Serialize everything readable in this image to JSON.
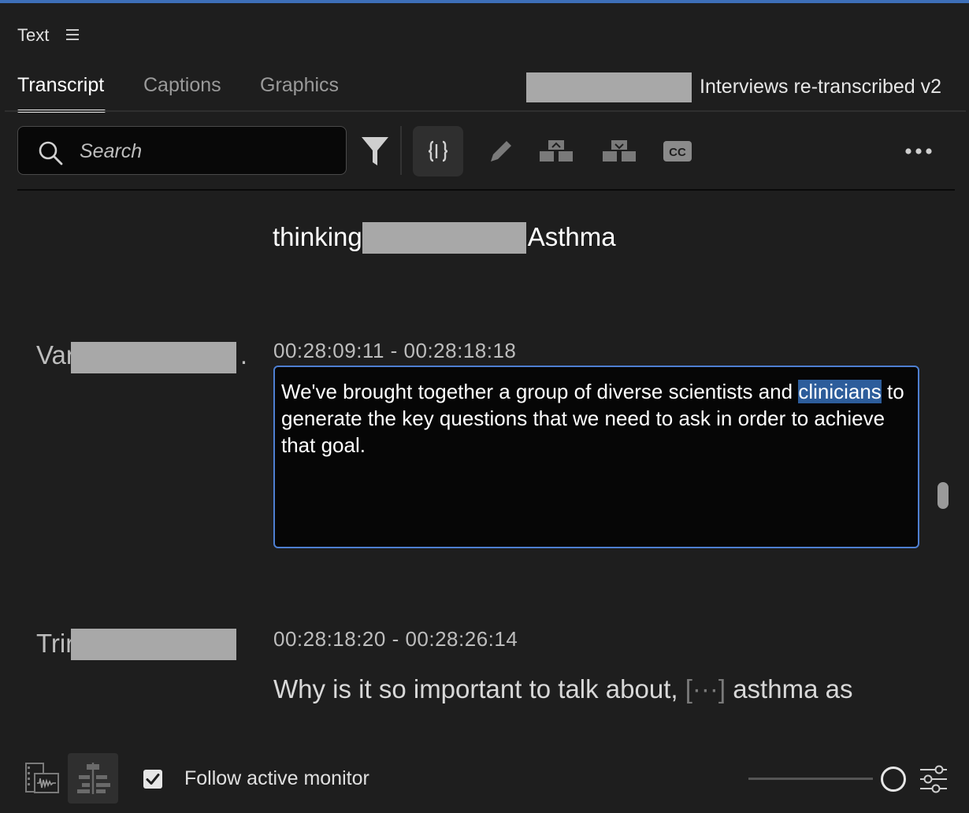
{
  "panel": {
    "title": "Text"
  },
  "tabs": [
    {
      "label": "Transcript",
      "active": true
    },
    {
      "label": "Captions",
      "active": false
    },
    {
      "label": "Graphics",
      "active": false
    }
  ],
  "sequence": {
    "title": "Interviews re-transcribed v2"
  },
  "search": {
    "placeholder": "Search"
  },
  "toolbar": {
    "icons": [
      "filter-icon",
      "merge-segments-icon",
      "edit-pencil-icon",
      "split-segment-icon",
      "merge-clips-icon",
      "create-captions-icon",
      "more-icon"
    ]
  },
  "transcript": {
    "prev_line": {
      "before": "thinking",
      "after": "Asthma"
    },
    "segments": [
      {
        "speaker_visible": "Var",
        "speaker_trailing": ".",
        "timecode": "00:28:09:11 - 00:28:18:18",
        "text_before": "We've brought together a group of diverse scientists and ",
        "text_highlight": "clinicians",
        "text_after": " to generate the key questions that we need to ask in order to achieve that goal."
      },
      {
        "speaker_visible": "Trir",
        "timecode": "00:28:18:20 - 00:28:26:14",
        "text_before": "Why is it so important to talk about, ",
        "ellipsis": "[···]",
        "text_after": " asthma as"
      }
    ]
  },
  "footer": {
    "follow_label": "Follow active monitor",
    "follow_checked": true,
    "zoom_level": 1.0
  },
  "colors": {
    "accent": "#4e7fd1",
    "highlight": "#2d5d9b",
    "background": "#1e1e1e"
  }
}
